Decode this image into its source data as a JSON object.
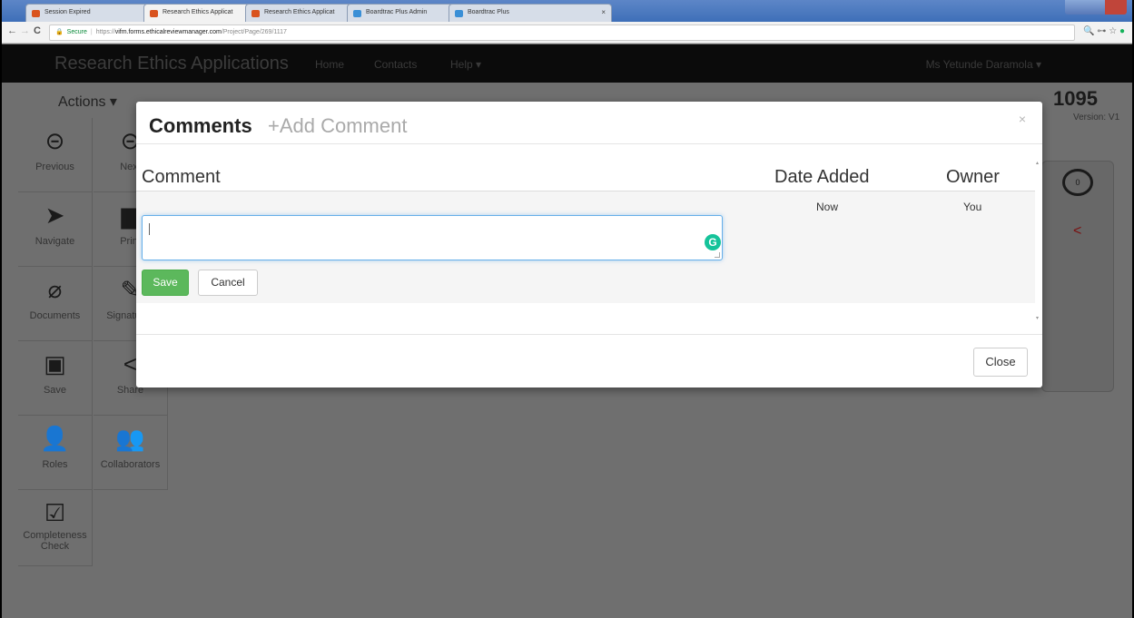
{
  "browser": {
    "tabs": [
      {
        "title": "Session Expired",
        "active": false,
        "favicon_color": "#d9531e"
      },
      {
        "title": "Research Ethics Applicat",
        "active": true,
        "favicon_color": "#d9531e"
      },
      {
        "title": "Research Ethics Applicat",
        "active": false,
        "favicon_color": "#d9531e"
      },
      {
        "title": "Boardtrac Plus Admin",
        "active": false,
        "favicon_color": "#3a8fd6"
      },
      {
        "title": "Boardtrac Plus",
        "active": false,
        "favicon_color": "#3a8fd6"
      }
    ],
    "tab_close": "×",
    "url": {
      "lock": "🔒",
      "secure": "Secure",
      "scheme": "https://",
      "host": "vifm.forms.ethicalreviewmanager.com",
      "path": "/Project/Page/269/1117"
    },
    "nav": {
      "back": "←",
      "forward": "→",
      "reload": "C"
    },
    "ext": {
      "zoom": "🔍",
      "key": "⊶",
      "star": "☆",
      "grammarly": "●"
    }
  },
  "app": {
    "brand": "Research Ethics Applications",
    "nav": [
      "Home",
      "Contacts",
      "Help ▾"
    ],
    "user": "Ms Yetunde Daramola ▾",
    "actions_label": "Actions ▾",
    "project_number": "1095",
    "version_label": "Version: V1",
    "comment_count": "0",
    "sidebar": [
      {
        "label": "Previous",
        "icon": "previous-icon",
        "glyph": "⊝"
      },
      {
        "label": "Next",
        "icon": "next-icon",
        "glyph": "⊝"
      },
      {
        "label": "Navigate",
        "icon": "navigate-icon",
        "glyph": "➤"
      },
      {
        "label": "Print",
        "icon": "print-icon",
        "glyph": "▆"
      },
      {
        "label": "Documents",
        "icon": "paperclip-icon",
        "glyph": "⌀"
      },
      {
        "label": "Signatures",
        "icon": "pen-icon",
        "glyph": "✎"
      },
      {
        "label": "Save",
        "icon": "save-icon",
        "glyph": "▣"
      },
      {
        "label": "Share",
        "icon": "share-icon",
        "glyph": "<"
      },
      {
        "label": "Roles",
        "icon": "add-user-icon",
        "glyph": "👤"
      },
      {
        "label": "Collaborators",
        "icon": "users-icon",
        "glyph": "👥"
      },
      {
        "label": "Completeness Check",
        "icon": "checkbox-icon",
        "glyph": "☑"
      }
    ]
  },
  "modal": {
    "title": "Comments",
    "add_comment": "+Add Comment",
    "close_x": "×",
    "columns": {
      "comment": "Comment",
      "date_added": "Date Added",
      "owner": "Owner"
    },
    "row": {
      "date": "Now",
      "owner": "You"
    },
    "input_value": "",
    "grammarly": "G",
    "save_label": "Save",
    "cancel_label": "Cancel",
    "close_label": "Close",
    "scroll_up": "▴",
    "scroll_down": "▾"
  },
  "colors": {
    "primary_green": "#5cb85c",
    "focus_blue": "#66afe9",
    "overlay": "#6f6f6f"
  }
}
